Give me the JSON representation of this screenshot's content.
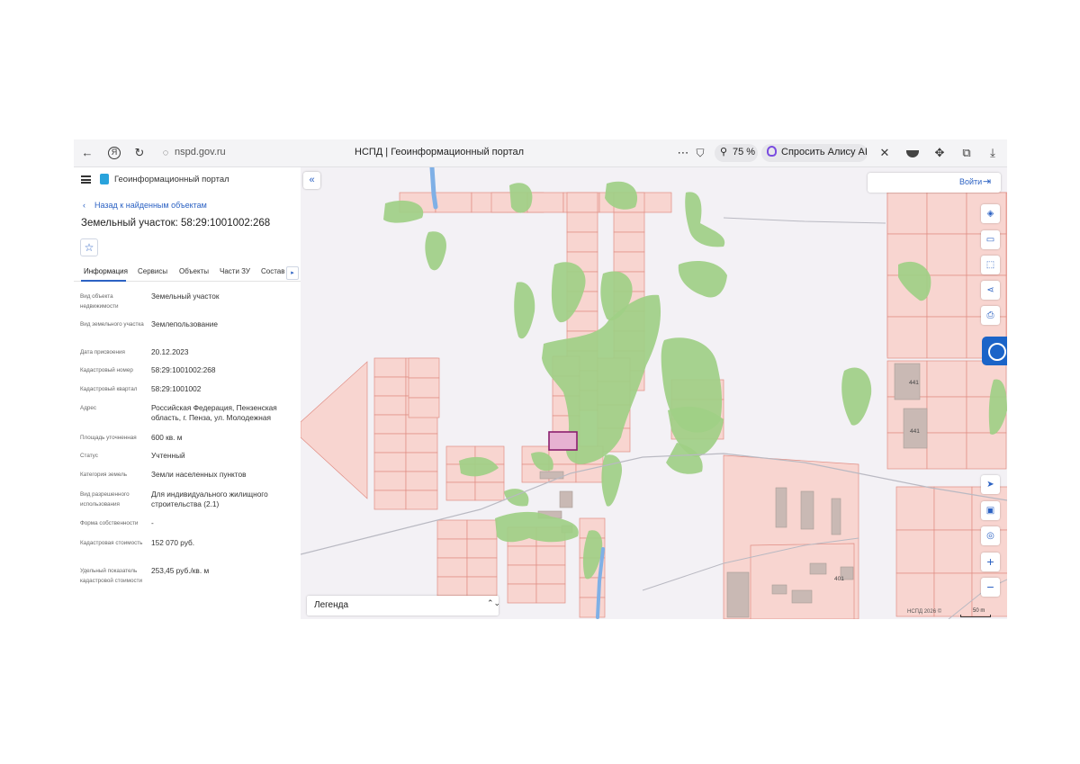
{
  "browser": {
    "url": "nspd.gov.ru",
    "title": "НСПД | Геоинформационный портал",
    "zoom": "75 %",
    "alice": "Спросить Алису AI",
    "icons": [
      "back-arrow-icon",
      "yandex-icon",
      "reload-icon",
      "site-info-icon",
      "more-icon",
      "bookmark-icon",
      "zoom-icon",
      "alice-icon",
      "extension-icon",
      "download-icon"
    ]
  },
  "panel": {
    "portal_title": "Геоинформационный портал",
    "back_chevron": "‹",
    "back_link": "Назад к найденным объектам",
    "object_title": "Земельный участок: 58:29:1001002:268",
    "favorite_icon": "☆",
    "tabs": [
      "Информация",
      "Сервисы",
      "Объекты",
      "Части ЗУ",
      "Состав"
    ],
    "tab_arrow": "▸",
    "fields": [
      {
        "label": "Вид объекта недвижимости",
        "value": "Земельный участок"
      },
      {
        "label": "Вид земельного участка",
        "value": "Землепользование"
      },
      {
        "label": "Дата присвоения",
        "value": "20.12.2023"
      },
      {
        "label": "Кадастровый номер",
        "value": "58:29:1001002:268"
      },
      {
        "label": "Кадастровый квартал",
        "value": "58:29:1001002"
      },
      {
        "label": "Адрес",
        "value": "Российская Федерация, Пензенская область, г. Пенза, ул. Молодежная"
      },
      {
        "label": "Площадь уточненная",
        "value": "600 кв. м"
      },
      {
        "label": "Статус",
        "value": "Учтенный"
      },
      {
        "label": "Категория земель",
        "value": "Земли населенных пунктов"
      },
      {
        "label": "Вид разрешенного использования",
        "value": "Для индивидуального жилищного строительства (2.1)"
      },
      {
        "label": "Форма собственности",
        "value": "-"
      },
      {
        "label": "Кадастровая стоимость",
        "value": "152 070 руб."
      },
      {
        "label": "Удельный показатель кадастровой стоимости",
        "value": "253,45 руб./кв. м"
      }
    ]
  },
  "map": {
    "collapse_icon": "«",
    "login_label": "Войти",
    "login_icon": "⇥",
    "tools": [
      "layers-icon",
      "ruler-icon",
      "select-area-icon",
      "share-icon",
      "print-icon",
      "locate-icon",
      "basemap-icon",
      "geo-pin-icon",
      "zoom-in-icon",
      "zoom-out-icon"
    ],
    "tool_glyphs": [
      "◈",
      "▭",
      "⬚",
      "⋖",
      "⎙",
      "➤",
      "▣",
      "◎",
      "+",
      "−"
    ],
    "legend_label": "Легенда",
    "legend_arrows": "⌃⌄",
    "copyright": "НСПД 2026 ©",
    "scale": "50 m",
    "house_numbers": [
      "441",
      "441",
      "401"
    ],
    "colors": {
      "parcel_fill": "#f8d5d0",
      "parcel_stroke": "#e08d84",
      "selected_fill": "#e7b2d2",
      "selected_stroke": "#8b1f6e",
      "vegetation": "#9fcf86",
      "building": "#c9b9b4",
      "water": "#7fb0e6",
      "accent": "#2c62c3"
    }
  }
}
